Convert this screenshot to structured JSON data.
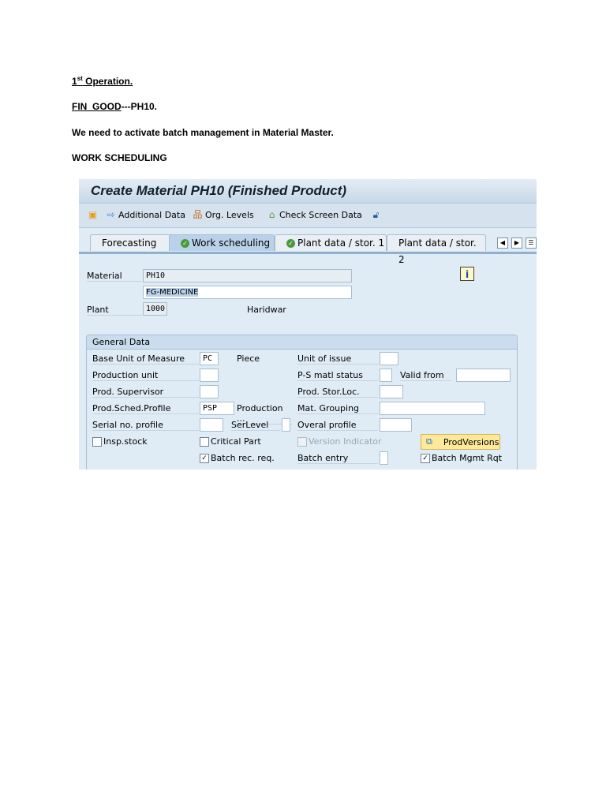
{
  "doc": {
    "op_num": "1",
    "op_sup": "st",
    "op_rest": " Operation.",
    "fin_good": "FIN_GOOD",
    "fin_rest": "---PH10.",
    "instruction": "We need to activate batch management in Material Master.",
    "section": "WORK SCHEDULING"
  },
  "sap": {
    "title": "Create Material PH10 (Finished Product)",
    "toolbar": {
      "additional_data": "Additional Data",
      "org_levels": "Org. Levels",
      "check_screen_data": "Check Screen Data"
    },
    "tabs": [
      "Forecasting",
      "Work scheduling",
      "Plant data / stor. 1",
      "Plant data / stor. 2"
    ],
    "header": {
      "material_label": "Material",
      "material_value": "PH10",
      "description": "FG-MEDICINE",
      "plant_label": "Plant",
      "plant_value": "1000",
      "plant_name": "Haridwar"
    },
    "general": {
      "title": "General Data",
      "base_uom_label": "Base Unit of Measure",
      "base_uom": "PC",
      "base_uom_text": "Piece",
      "unit_issue_label": "Unit of issue",
      "production_unit_label": "Production unit",
      "ps_status_label": "P-S matl status",
      "valid_from_label": "Valid from",
      "supervisor_label": "Prod. Supervisor",
      "stor_loc_label": "Prod. Stor.Loc.",
      "sched_profile_label": "Prod.Sched.Profile",
      "sched_profile": "PSP",
      "sched_profile_text": "Production ...",
      "mat_grouping_label": "Mat. Grouping",
      "serial_label": "Serial no. profile",
      "serlevel_label": "SerLevel",
      "overal_label": "Overal profile",
      "insp_stock": "Insp.stock",
      "critical_part": "Critical Part",
      "version_indicator": "Version Indicator",
      "prod_versions": "ProdVersions",
      "batch_rec": "Batch rec. req.",
      "batch_entry_label": "Batch entry",
      "batch_mgmt": "Batch Mgmt Rqt"
    }
  }
}
